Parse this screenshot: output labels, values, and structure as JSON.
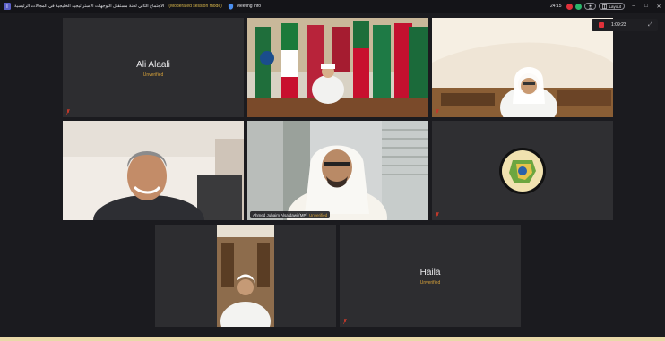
{
  "titlebar": {
    "title": "الاجتماع الثاني لجنة مستقبل التوجهات الاستراتيجية الخليجية في المجالات الرئيسية",
    "separator": "(Moderated session mode)",
    "info_label": "Meeting info",
    "timer": "24:15",
    "layout_label": "Layout",
    "window_controls": [
      "–",
      "□",
      "✕"
    ],
    "colors": {
      "leave": "#e0313a",
      "camera": "#2bb56b"
    }
  },
  "recording": {
    "time": "1:09:23"
  },
  "participants": [
    {
      "id": "ali",
      "name": "Ali Alaali",
      "status": "Unverified",
      "video": false
    },
    {
      "id": "chair",
      "video": true
    },
    {
      "id": "man-top-right",
      "video": true
    },
    {
      "id": "man-smiling",
      "video": true
    },
    {
      "id": "ahmed",
      "name": "Ahmed Juhaim Alsaidawi (MP)",
      "status": "Unverified",
      "video": true,
      "active_speaker": true
    },
    {
      "id": "gcc-logo",
      "video": true
    },
    {
      "id": "man-office",
      "video": true
    },
    {
      "id": "haila",
      "name": "Haila",
      "status": "Unverified",
      "video": false
    }
  ],
  "colors": {
    "page_background": "#e9d9a9",
    "window_background": "#1b1b1f",
    "tile_background": "#2d2d30",
    "active_speaker_border": "#27b5a8",
    "status_text": "#d6a13a"
  }
}
